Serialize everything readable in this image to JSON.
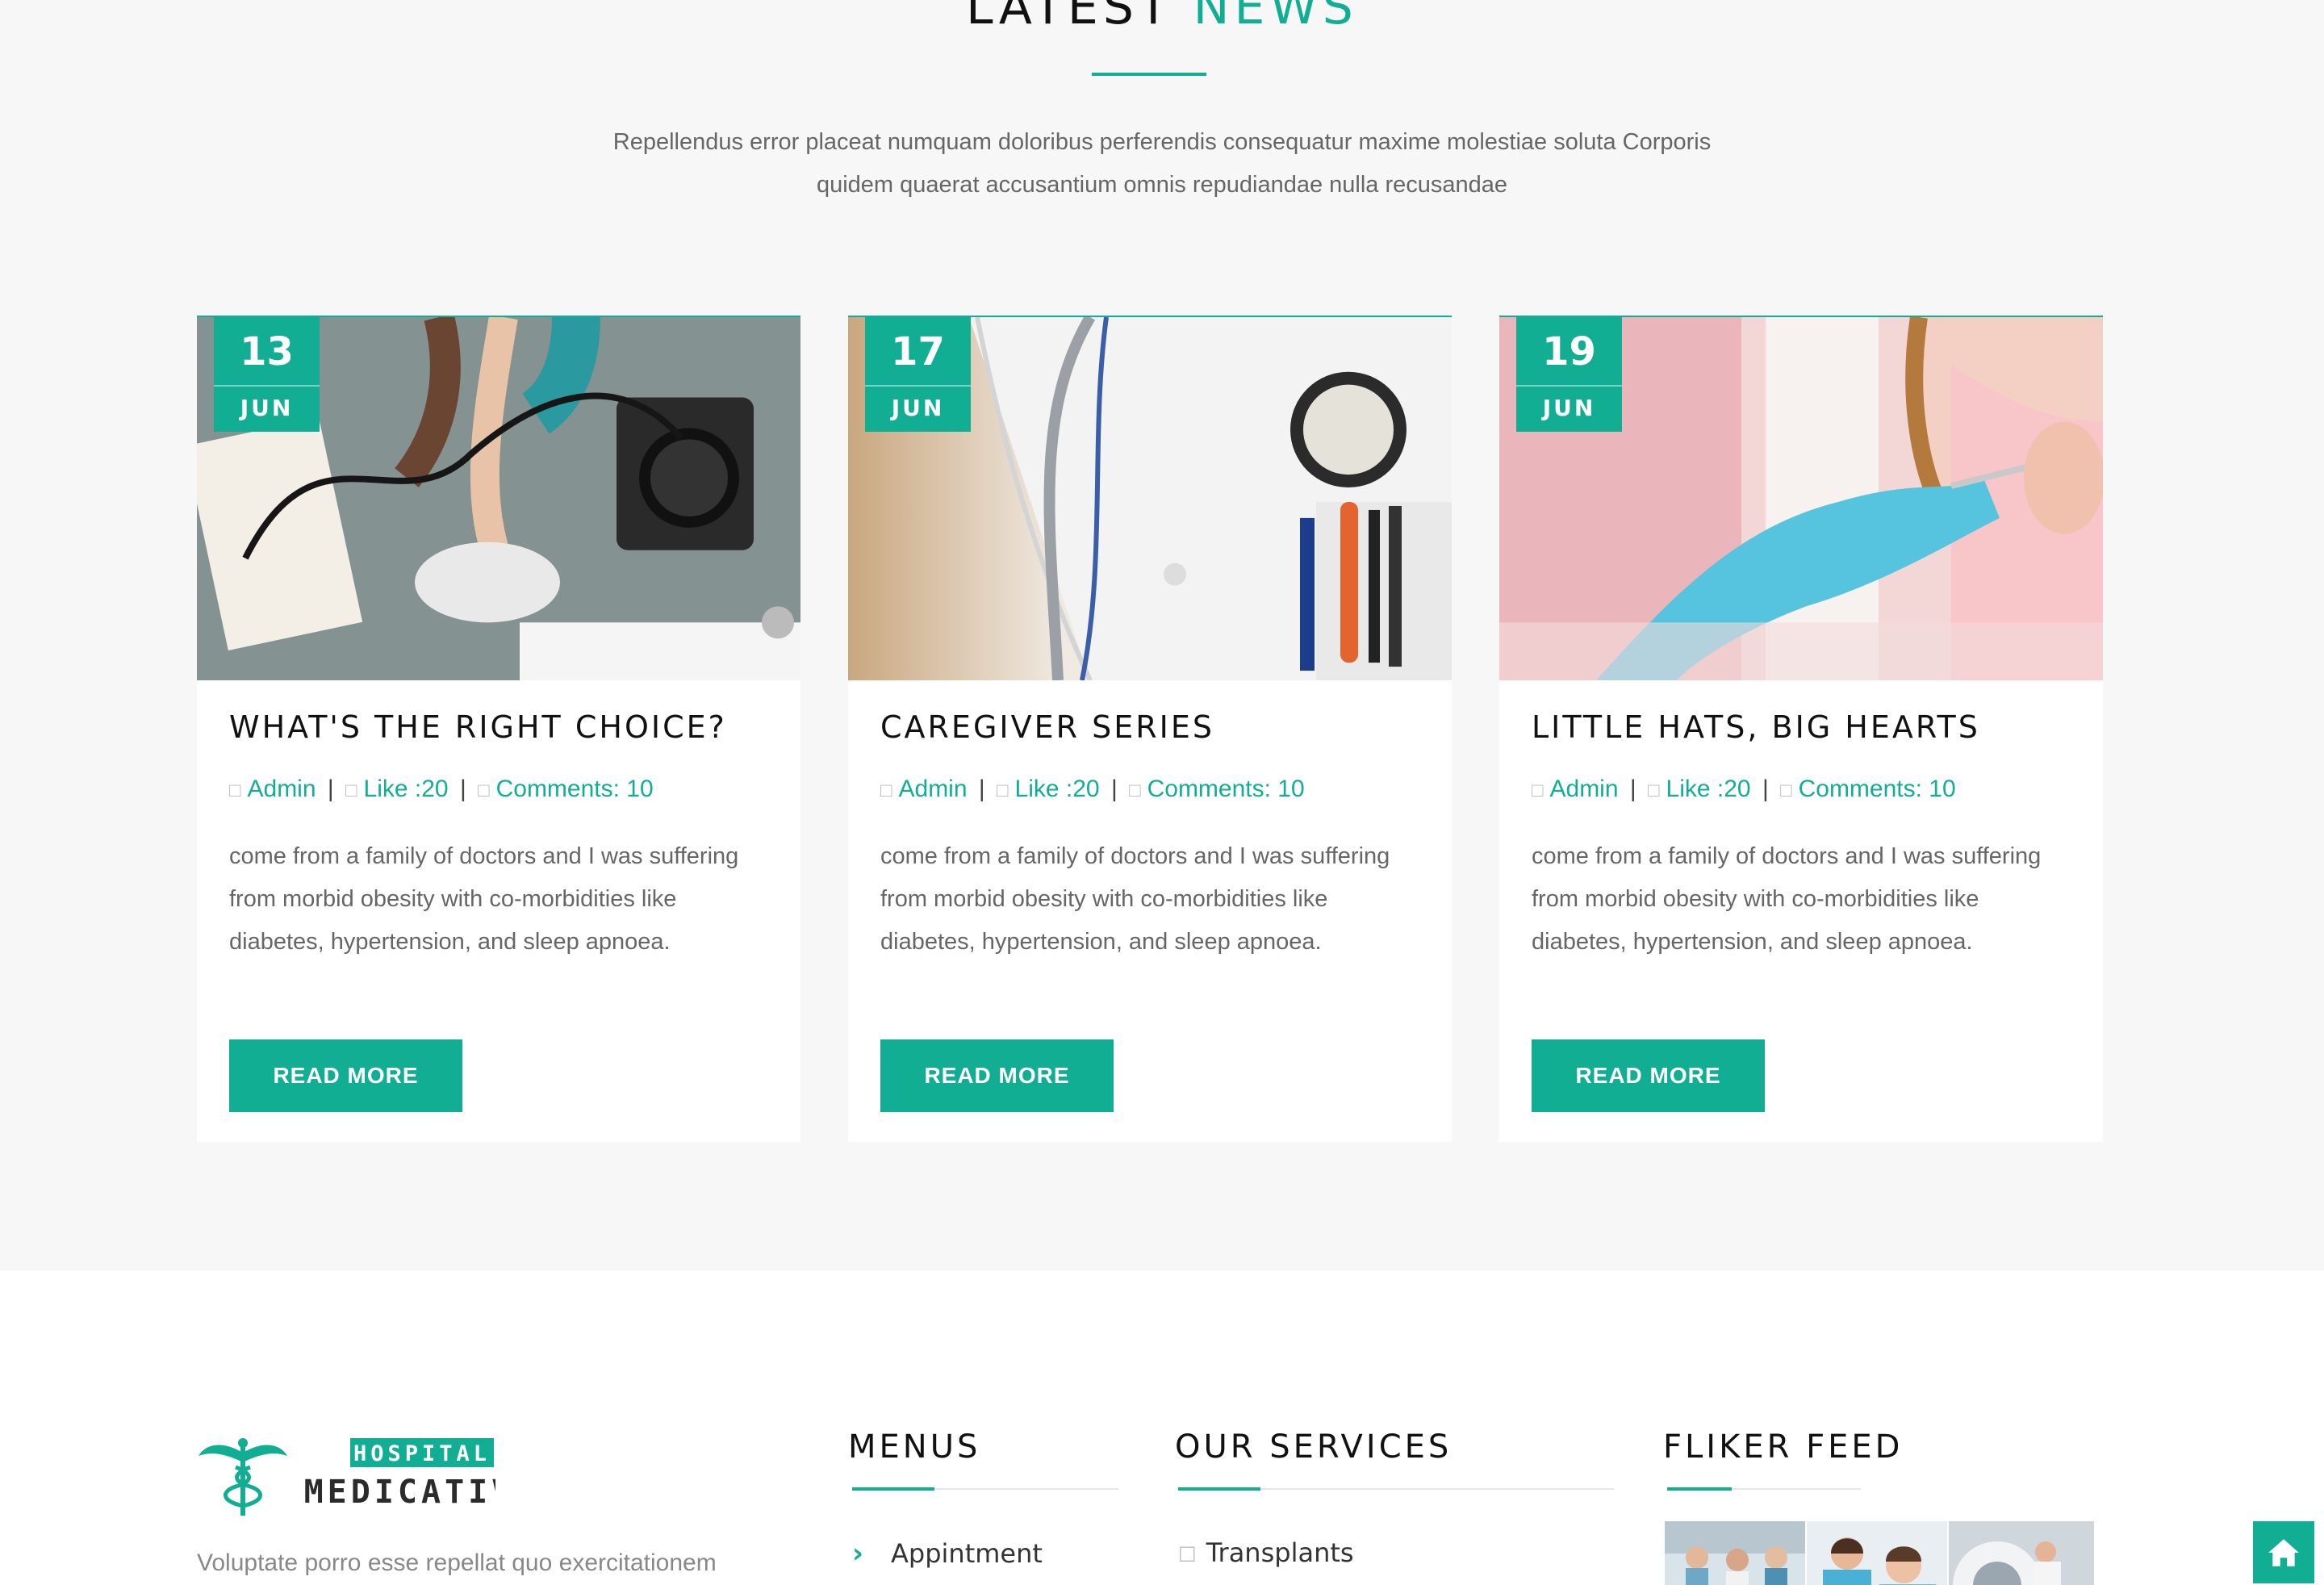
{
  "news": {
    "title_plain": "LATEST",
    "title_accent": "NEWS",
    "subtitle_line1": "Repellendus error placeat numquam doloribus perferendis consequatur maxime molestiae soluta Corporis",
    "subtitle_line2": "quidem quaerat accusantium omnis repudiandae nulla recusandae",
    "posts": [
      {
        "day": "13",
        "month": "JUN",
        "title": "WHAT'S THE RIGHT CHOICE?",
        "author": "Admin",
        "likes": "Like :20",
        "comments": "Comments: 10",
        "text": "come from a family of doctors and I was suffering from morbid obesity with co-morbidities like diabetes, hypertension, and sleep apnoea.",
        "button": "READ MORE"
      },
      {
        "day": "17",
        "month": "JUN",
        "title": "CAREGIVER SERIES",
        "author": "Admin",
        "likes": "Like :20",
        "comments": "Comments: 10",
        "text": "come from a family of doctors and I was suffering from morbid obesity with co-morbidities like diabetes, hypertension, and sleep apnoea.",
        "button": "READ MORE"
      },
      {
        "day": "19",
        "month": "JUN",
        "title": "LITTLE HATS, BIG HEARTS",
        "author": "Admin",
        "likes": "Like :20",
        "comments": "Comments: 10",
        "text": "come from a family of doctors and I was suffering from morbid obesity with co-morbidities like diabetes, hypertension, and sleep apnoea.",
        "button": "READ MORE"
      }
    ]
  },
  "footer": {
    "logo_top": "HOSPITAL",
    "logo_bottom": "MEDICATIVE",
    "description": "Voluptate porro esse repellat quo exercitationem",
    "menus_title": "MENUS",
    "menus_first": "Appintment",
    "services_title": "OUR SERVICES",
    "services_first": "Transplants",
    "flickr_title": "FLIKER FEED"
  },
  "icons": {
    "meta_icon": "square-placeholder-icon",
    "menu_bullet": "chevron-right-icon",
    "home_button": "home-icon"
  },
  "colors": {
    "accent": "#12ae94",
    "section_bg": "#f7f7f7",
    "heading": "#111111",
    "body_text": "#666666"
  }
}
